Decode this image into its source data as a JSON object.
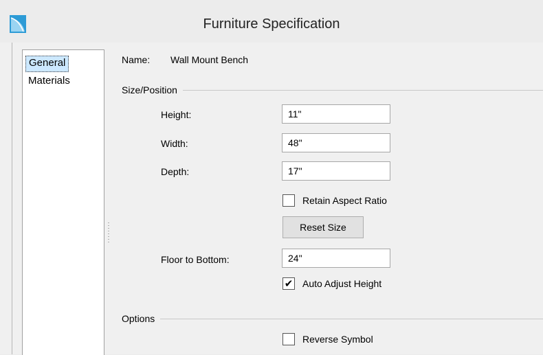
{
  "window": {
    "title": "Furniture Specification"
  },
  "nav": {
    "items": [
      {
        "label": "General",
        "selected": true
      },
      {
        "label": "Materials",
        "selected": false
      }
    ]
  },
  "general": {
    "name_label": "Name:",
    "name_value": "Wall Mount Bench",
    "size_position": {
      "group_label": "Size/Position",
      "height_label": "Height:",
      "height_value": "11\"",
      "width_label": "Width:",
      "width_value": "48\"",
      "depth_label": "Depth:",
      "depth_value": "17\"",
      "retain_aspect_label": "Retain Aspect Ratio",
      "retain_aspect_checked": false,
      "reset_size_label": "Reset Size",
      "floor_to_bottom_label": "Floor to Bottom:",
      "floor_to_bottom_value": "24\"",
      "auto_adjust_label": "Auto Adjust Height",
      "auto_adjust_checked": true
    },
    "options": {
      "group_label": "Options",
      "reverse_symbol_label": "Reverse Symbol",
      "reverse_symbol_checked": false
    }
  },
  "icons": {
    "app": "app-icon",
    "check": "checkmark-icon"
  },
  "colors": {
    "selection": "#cce8ff",
    "background": "#f0f0f0",
    "app_icon": "#2d9bd6"
  }
}
